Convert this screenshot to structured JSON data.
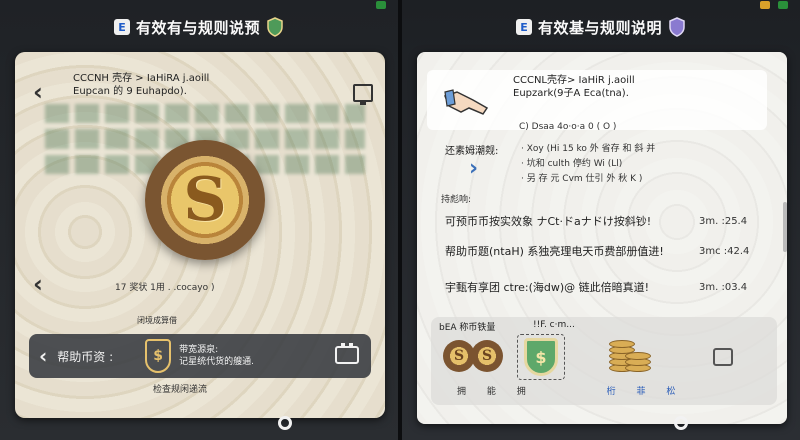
{
  "left": {
    "title": "有效有与规则说预",
    "header_lines": [
      "CCCNH 壳存 > IaHiRA j.aoill",
      "Eupcan 的 9 Euhapdo)."
    ],
    "coin_caption": "17 奖状 1用 . .cocayo )",
    "bottom_label": "闭境成算借",
    "bar_label": "帮助币资 :",
    "bar_coin_symbol": "$",
    "bar_text_title": "带宽源泉:",
    "bar_text_sub": "记星统代货的艘通.",
    "bottom_caption": "检查规闲递流"
  },
  "right": {
    "title": "有效基与规则说明",
    "header_lines": [
      "CCCNL壳存> IaHiR j.aoill",
      "Eupzark(9子A Eca(tna)."
    ],
    "sub_line": "C) Dsaa 4o·o·a 0 ( O )",
    "note_label": "还素姆潮觌:",
    "note_lines": [
      "· Xoy (Hi 15 ko 外 省存 和 斜 并",
      "· 坑和 culth 停约 Wi (Ll)",
      "· 另 存 元 Cvm 仕引 外 秋 K )"
    ],
    "list_label": "持彪响:",
    "rows": [
      {
        "text": "可预币币按实效象 ナCt·ドaナドけ按斜钞!",
        "value": "3m. :25.4"
      },
      {
        "text": "帮助币题(ntaH) 系独亮理电天币费部册值进!",
        "value": "3mc :42.4"
      },
      {
        "text": "宇甄有享团 ctre:(海dw)@ 链此倍暗真道!",
        "value": "3m. :03.4"
      }
    ],
    "bottom_label1": "bEA 称币铁量",
    "bottom_label2": "!!F. c·m...",
    "shield_symbol": "$",
    "coin_symbol": "S",
    "bottom_caption": [
      "拥 能 拥",
      "桁 菲 松"
    ]
  },
  "colors": {
    "accent_blue": "#2b5db8",
    "shield_green": "#5ea86a",
    "gold": "#e6c16c"
  }
}
